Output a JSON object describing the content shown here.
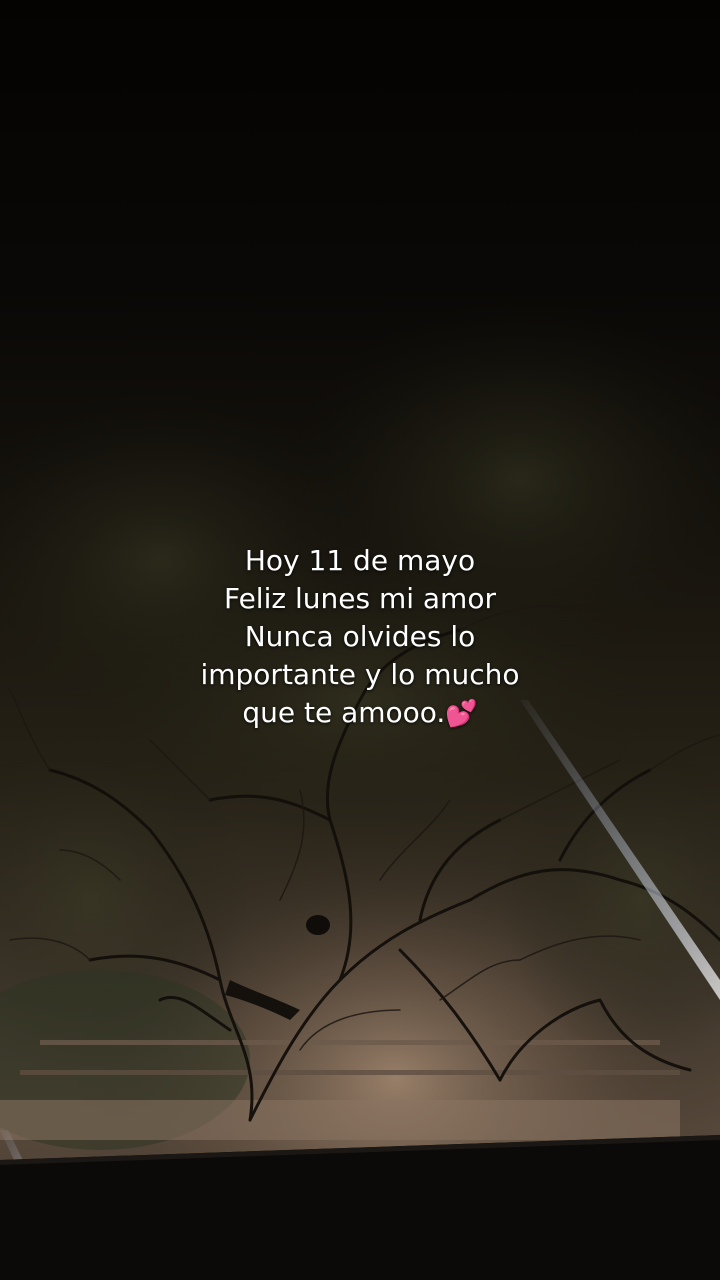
{
  "caption": {
    "lines": [
      "Hoy 11 de mayo",
      "Feliz lunes mi amor",
      "Nunca olvides lo",
      "importante y lo mucho",
      "que te amooo."
    ],
    "emoji": "💕"
  },
  "colors": {
    "night_sky": "#050302",
    "ground_lit": "#8a7360",
    "foliage": "#2b2a1c",
    "branches": "#1a140f",
    "caption_text": "#ffffff"
  },
  "icons": {
    "heart": "two-hearts-icon"
  }
}
